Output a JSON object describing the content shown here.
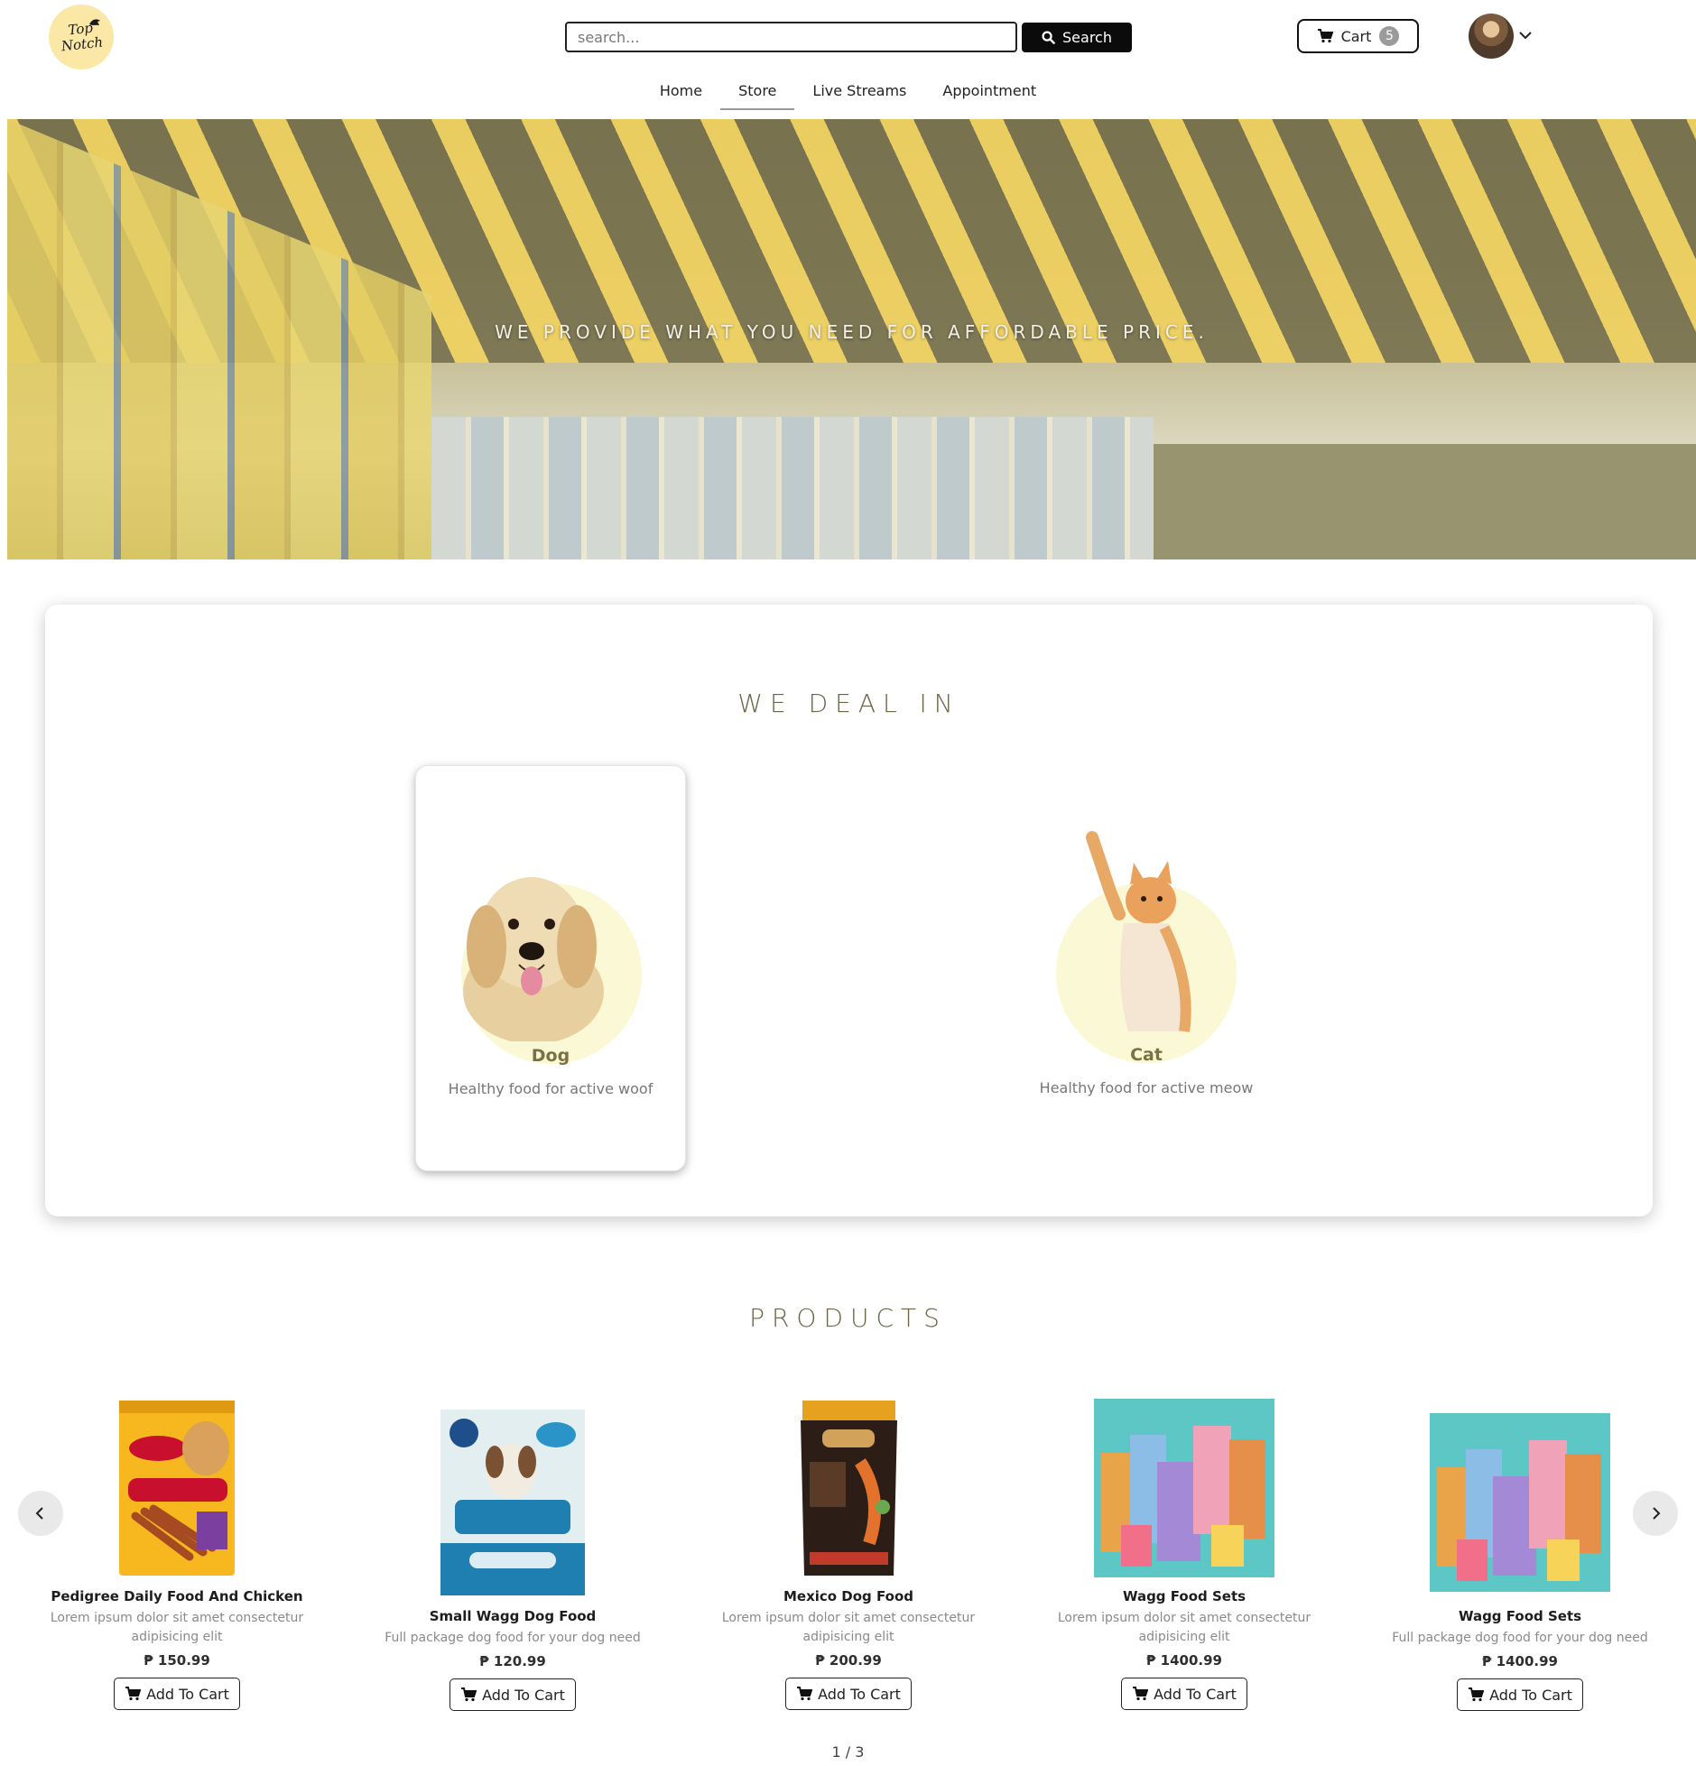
{
  "header": {
    "logo_line1": "Top",
    "logo_line2": "Notch",
    "search_placeholder": "search...",
    "search_button": "Search",
    "cart_label": "Cart",
    "cart_count": "5"
  },
  "nav": {
    "items": [
      {
        "label": "Home"
      },
      {
        "label": "Store"
      },
      {
        "label": "Live Streams"
      },
      {
        "label": "Appointment"
      }
    ],
    "active": "Store"
  },
  "hero": {
    "tagline": "WE PROVIDE WHAT YOU NEED FOR AFFORDABLE PRICE."
  },
  "deal": {
    "title": "WE DEAL IN",
    "items": [
      {
        "name": "Dog",
        "desc": "Healthy food for active woof"
      },
      {
        "name": "Cat",
        "desc": "Healthy food for active meow"
      }
    ]
  },
  "products": {
    "title": "PRODUCTS",
    "currency": "₱",
    "add_label": "Add To Cart",
    "items": [
      {
        "name": "Pedigree Daily Food And Chicken",
        "desc": "Lorem ipsum dolor sit amet consectetur adipisicing elit",
        "price": "₱ 150.99"
      },
      {
        "name": "Small Wagg Dog Food",
        "desc": "Full package dog food for your dog need",
        "price": "₱ 120.99"
      },
      {
        "name": "Mexico Dog Food",
        "desc": "Lorem ipsum dolor sit amet consectetur adipisicing elit",
        "price": "₱ 200.99"
      },
      {
        "name": "Wagg Food Sets",
        "desc": "Lorem ipsum dolor sit amet consectetur adipisicing elit",
        "price": "₱ 1400.99"
      },
      {
        "name": "Wagg Food Sets",
        "desc": "Full package dog food for your dog need",
        "price": "₱ 1400.99"
      }
    ],
    "pager": "1 / 3"
  },
  "colors": {
    "accent_yellow": "#fbe8a6",
    "title_brown": "#6b6445",
    "dark_button": "#0b0b0b"
  },
  "icons": [
    "search-icon",
    "cart-icon",
    "chevron-down-icon",
    "chevron-left-icon",
    "chevron-right-icon"
  ]
}
